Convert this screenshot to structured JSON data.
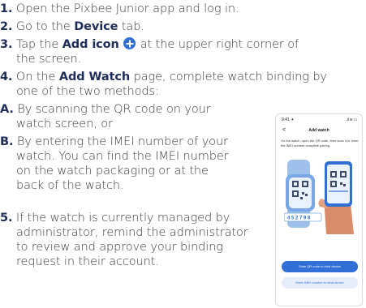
{
  "steps": {
    "s1": {
      "num": "1.",
      "text": " Open the Pixbee Junior app and log in."
    },
    "s2": {
      "num": "2.",
      "pre": " Go to the ",
      "bold": "Device",
      "post": " tab."
    },
    "s3": {
      "num": "3.",
      "pre": " Tap the ",
      "bold": "Add icon",
      "post": " at the upper right corner of",
      "line2": "the screen."
    },
    "s4": {
      "num": "4.",
      "pre": " On the ",
      "bold": "Add Watch",
      "post": " page, complete watch binding by",
      "line2": "one of the two methods:"
    },
    "sA": {
      "num": "A.",
      "text": " By scanning the QR code on your",
      "line2": "watch screen, or"
    },
    "sB": {
      "num": "B.",
      "text": " By entering the IMEI number of your",
      "line2": "watch. You can find the IMEI number",
      "line3": "on the watch packaging or at the",
      "line4": "back of the watch."
    },
    "s5": {
      "num": "5.",
      "text": " If the watch is currently managed by",
      "line2": "administrator, remind the administrator",
      "line3": "to review and approve your binding",
      "line4": "request in their account."
    }
  },
  "add_icon": {
    "icon": "plus-circle-icon",
    "color": "#2f6fd6"
  },
  "phone": {
    "time": "9:41 ✈",
    "signal": "..ıl ≋ ▭",
    "back": "<",
    "title": "Add watch",
    "instruction": "On the watch, open the QR code, then scan it or enter the IMEI number complete pairing.",
    "watch_digits": "4 5 2 7 9 8",
    "scan_button": "Scan QR code to bind device",
    "imei_button": "Enter IMEI number to bind device"
  },
  "colors": {
    "accent": "#2f6fd6",
    "heading": "#1f2d5a",
    "body_text": "#3c3c3c"
  }
}
